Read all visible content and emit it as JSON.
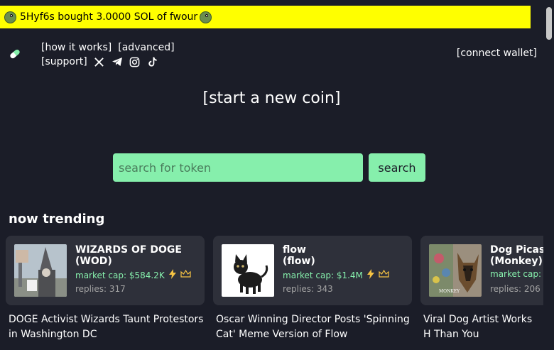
{
  "ticker": {
    "text": "5Hyf6s bought 3.0000 SOL of fwour"
  },
  "nav": {
    "how_it_works": "[how it works]",
    "advanced": "[advanced]",
    "support": "[support]",
    "connect_wallet": "[connect wallet]"
  },
  "start_coin": "[start a new coin]",
  "search": {
    "placeholder": "search for token",
    "button": "search"
  },
  "trending": {
    "title": "now trending",
    "cards": [
      {
        "name": "WIZARDS OF DOGE",
        "ticker": "(WOD)",
        "market_cap": "market cap: $584.2K",
        "replies": "replies: 317"
      },
      {
        "name": "flow",
        "ticker": "(flow)",
        "market_cap": "market cap: $1.4M",
        "replies": "replies: 343"
      },
      {
        "name": "Dog Picas",
        "ticker": "(Monkey)",
        "market_cap": "market cap:",
        "replies": "replies: 206",
        "image_text": "MONKEY"
      }
    ],
    "headlines": [
      "DOGE Activist Wizards Taunt Protestors in Washington DC",
      "Oscar Winning Director Posts 'Spinning Cat' Meme Version of Flow",
      "Viral Dog Artist Works H Than You"
    ]
  },
  "colors": {
    "accent": "#86efac",
    "ticker_bg": "#ffff00",
    "background": "#1b1d28",
    "card_bg": "#2e303a"
  }
}
